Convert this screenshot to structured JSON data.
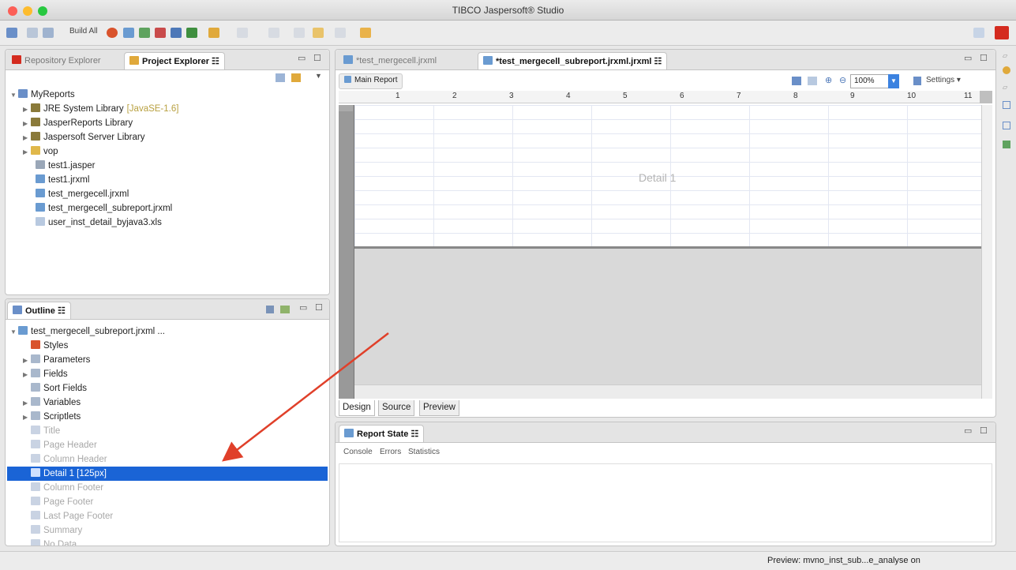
{
  "window": {
    "title": "TIBCO Jaspersoft® Studio"
  },
  "toolbar": {
    "build_all_label": "Build All"
  },
  "explorer": {
    "tabs": [
      "Repository Explorer",
      "Project Explorer ☷"
    ],
    "tree": [
      {
        "label": "MyReports",
        "icon": "project-icon"
      },
      {
        "label": "JRE System Library",
        "suffix": "[JavaSE-1.6]",
        "icon": "library-icon"
      },
      {
        "label": "JasperReports Library",
        "icon": "library-icon"
      },
      {
        "label": "Jaspersoft Server Library",
        "icon": "library-icon"
      },
      {
        "label": "vop",
        "icon": "folder-icon"
      },
      {
        "label": "test1.jasper",
        "icon": "jasper-file-icon"
      },
      {
        "label": "test1.jrxml",
        "icon": "jrxml-file-icon"
      },
      {
        "label": "test_mergecell.jrxml",
        "icon": "jrxml-file-icon"
      },
      {
        "label": "test_mergecell_subreport.jrxml",
        "icon": "jrxml-file-icon"
      },
      {
        "label": "user_inst_detail_byjava3.xls",
        "icon": "xls-file-icon"
      }
    ]
  },
  "outline": {
    "tab": "Outline ☷",
    "root": "test_mergecell_subreport.jrxml ...",
    "items": [
      {
        "label": "Styles",
        "dim": false
      },
      {
        "label": "Parameters",
        "dim": false
      },
      {
        "label": "Fields",
        "dim": false
      },
      {
        "label": "Sort Fields",
        "dim": false
      },
      {
        "label": "Variables",
        "dim": false
      },
      {
        "label": "Scriptlets",
        "dim": false
      },
      {
        "label": "Title",
        "dim": true
      },
      {
        "label": "Page Header",
        "dim": true
      },
      {
        "label": "Column Header",
        "dim": true
      },
      {
        "label": "Detail 1 [125px]",
        "dim": false,
        "selected": true
      },
      {
        "label": "Column Footer",
        "dim": true
      },
      {
        "label": "Page Footer",
        "dim": true
      },
      {
        "label": "Last Page Footer",
        "dim": true
      },
      {
        "label": "Summary",
        "dim": true
      },
      {
        "label": "No Data",
        "dim": true
      }
    ]
  },
  "editor": {
    "tabs": [
      "*test_mergecell.jrxml",
      "*test_mergecell_subreport.jrxml.jrxml ☷"
    ],
    "main_report_label": "Main Report",
    "zoom": "100%",
    "settings_label": "Settings",
    "ruler_numbers": [
      "1",
      "2",
      "3",
      "4",
      "5",
      "6",
      "7",
      "8",
      "9",
      "10",
      "11"
    ],
    "band_label": "Detail 1",
    "bottom_tabs": [
      "Design",
      "Source",
      "Preview"
    ]
  },
  "report_state": {
    "title": "Report State ☷",
    "subtabs": [
      "Console",
      "Errors",
      "Statistics"
    ]
  },
  "status": {
    "text": "Preview: mvno_inst_sub...e_analyse on"
  },
  "colors": {
    "selection": "#1a64d6",
    "annotation_arrow": "#e0402a"
  }
}
